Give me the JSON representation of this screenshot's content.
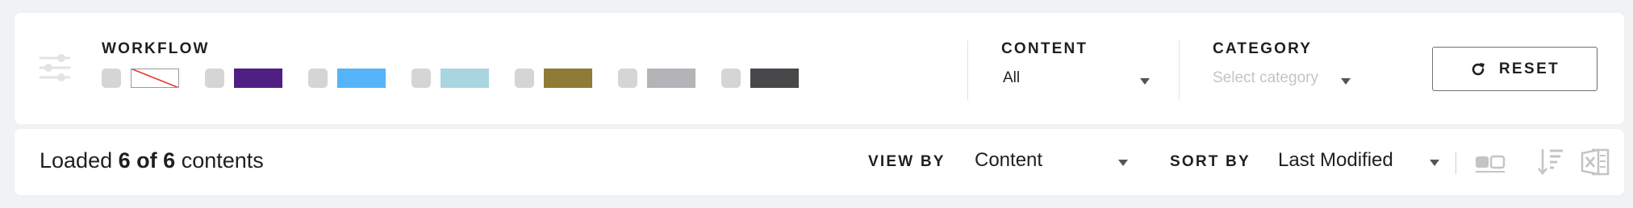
{
  "filters": {
    "workflow_label": "WORKFLOW",
    "workflow_items": [
      {
        "color": "none"
      },
      {
        "color": "#4f1f83"
      },
      {
        "color": "#55b4f9"
      },
      {
        "color": "#a9d5e0"
      },
      {
        "color": "#8f7b35"
      },
      {
        "color": "#b4b4b8"
      },
      {
        "color": "#48484b"
      }
    ],
    "content_label": "CONTENT",
    "content_value": "All",
    "category_label": "CATEGORY",
    "category_placeholder": "Select category",
    "reset_label": "RESET"
  },
  "results": {
    "loaded_prefix": "Loaded",
    "loaded_count": "6",
    "loaded_of": "of",
    "loaded_total": "6",
    "loaded_suffix": "contents",
    "viewby_label": "VIEW BY",
    "viewby_value": "Content",
    "sortby_label": "SORT BY",
    "sortby_value": "Last Modified"
  },
  "icons": {
    "filter": "sliders-icon",
    "reset": "refresh-icon",
    "toggle_view": "toggle-view-icon",
    "sort_order": "sort-descending-icon",
    "excel": "excel-export-icon"
  }
}
